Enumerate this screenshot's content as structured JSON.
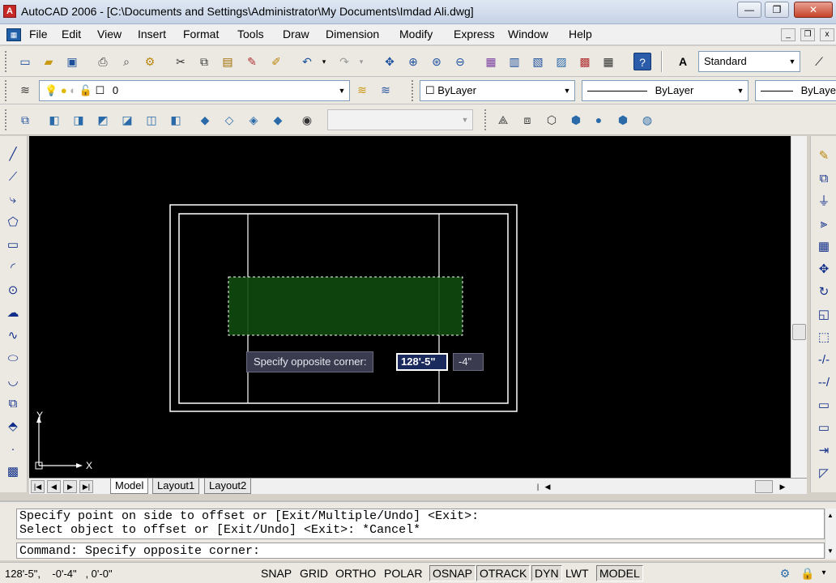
{
  "window": {
    "title": "AutoCAD 2006 - [C:\\Documents and Settings\\Administrator\\My Documents\\Imdad Ali.dwg]",
    "minimize": "—",
    "restore": "❐",
    "close": "✕"
  },
  "menu": {
    "items": [
      "File",
      "Edit",
      "View",
      "Insert",
      "Format",
      "Tools",
      "Draw",
      "Dimension",
      "Modify",
      "Express",
      "Window",
      "Help"
    ],
    "doc_minimize": "_",
    "doc_restore": "❐",
    "doc_close": "x"
  },
  "toolbar_standard": {
    "text_style": "Standard"
  },
  "toolbar_layers": {
    "layer_name": "0",
    "color": "ByLayer",
    "linetype": "ByLayer",
    "lineweight": "ByLayer"
  },
  "drawing": {
    "tooltip_prompt": "Specify opposite corner:",
    "tooltip_value1": "128'-5\"",
    "tooltip_value2": "-4\"",
    "ucs_x": "X",
    "ucs_y": "Y"
  },
  "tabs": {
    "items": [
      "Model",
      "Layout1",
      "Layout2"
    ],
    "active": "Model"
  },
  "command": {
    "history_line1": "Specify point on side to offset or [Exit/Multiple/Undo] <Exit>:",
    "history_line2": "Select object to offset or [Exit/Undo] <Exit>: *Cancel*",
    "current": "Command: Specify opposite corner:"
  },
  "statusbar": {
    "coordinates": "128'-5\",    -0'-4\"   , 0'-0\"",
    "toggles": [
      {
        "label": "SNAP",
        "on": false
      },
      {
        "label": "GRID",
        "on": false
      },
      {
        "label": "ORTHO",
        "on": false
      },
      {
        "label": "POLAR",
        "on": false
      },
      {
        "label": "OSNAP",
        "on": true
      },
      {
        "label": "OTRACK",
        "on": true
      },
      {
        "label": "DYN",
        "on": true
      },
      {
        "label": "LWT",
        "on": false
      },
      {
        "label": "MODEL",
        "on": true
      }
    ]
  },
  "colors": {
    "canvas_bg": "#000000",
    "drawing_lines": "#ffffff",
    "selection_fill": "#0f4a0f",
    "selection_border": "#ffffff"
  }
}
